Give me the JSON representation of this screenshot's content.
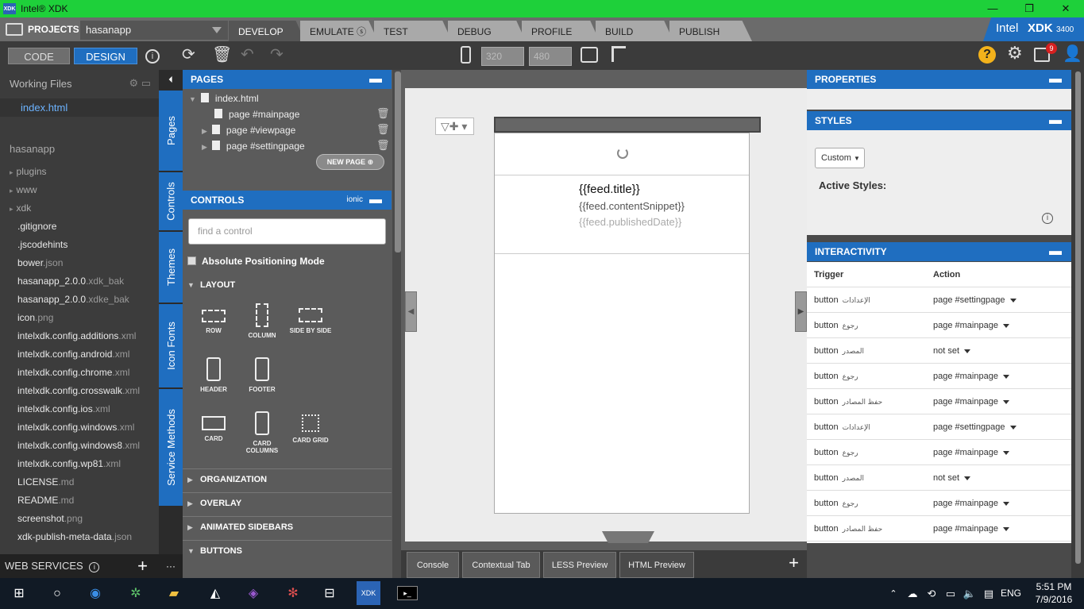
{
  "window": {
    "title": "Intel® XDK",
    "icon_text": "XDK",
    "minimize": "—",
    "maximize": "❐",
    "close": "✕"
  },
  "tabs": {
    "projects_label": "PROJECTS",
    "project_name": "hasanapp",
    "main": [
      {
        "label": "DEVELOP",
        "active": true
      },
      {
        "label": "EMULATE ⓢ"
      },
      {
        "label": "TEST"
      },
      {
        "label": "DEBUG"
      },
      {
        "label": "PROFILE"
      },
      {
        "label": "BUILD"
      },
      {
        "label": "PUBLISH"
      }
    ],
    "brand": "Intel",
    "brand_product": "XDK",
    "brand_version": "3400"
  },
  "toolbar": {
    "code_label": "CODE",
    "design_label": "DESIGN",
    "width_value": "320",
    "height_value": "480",
    "notification_count": "9"
  },
  "files": {
    "header": "Working Files",
    "open_file": "index.html",
    "project": "hasanapp",
    "folders": [
      "plugins",
      "www",
      "xdk"
    ],
    "items": [
      {
        "name": ".gitignore",
        "ext": ""
      },
      {
        "name": ".jscodehints",
        "ext": ""
      },
      {
        "name": "bower",
        "ext": ".json"
      },
      {
        "name": "hasanapp_2.0.0",
        "ext": ".xdk_bak"
      },
      {
        "name": "hasanapp_2.0.0",
        "ext": ".xdke_bak"
      },
      {
        "name": "icon",
        "ext": ".png"
      },
      {
        "name": "intelxdk.config.additions",
        "ext": ".xml"
      },
      {
        "name": "intelxdk.config.android",
        "ext": ".xml"
      },
      {
        "name": "intelxdk.config.chrome",
        "ext": ".xml"
      },
      {
        "name": "intelxdk.config.crosswalk",
        "ext": ".xml"
      },
      {
        "name": "intelxdk.config.ios",
        "ext": ".xml"
      },
      {
        "name": "intelxdk.config.windows",
        "ext": ".xml"
      },
      {
        "name": "intelxdk.config.windows8",
        "ext": ".xml"
      },
      {
        "name": "intelxdk.config.wp81",
        "ext": ".xml"
      },
      {
        "name": "LICENSE",
        "ext": ".md"
      },
      {
        "name": "README",
        "ext": ".md"
      },
      {
        "name": "screenshot",
        "ext": ".png"
      },
      {
        "name": "xdk-publish-meta-data",
        "ext": ".json"
      }
    ],
    "web_services": "WEB SERVICES"
  },
  "vtabs": [
    "Pages",
    "Controls",
    "Themes",
    "Icon Fonts",
    "Service Methods"
  ],
  "pages_panel": {
    "header": "PAGES",
    "root": "index.html",
    "pages": [
      "page #mainpage",
      "page #viewpage",
      "page #settingpage"
    ],
    "new_page": "NEW PAGE"
  },
  "controls_panel": {
    "header": "CONTROLS",
    "framework": "ionic",
    "search_placeholder": "find a control",
    "abs_positioning": "Absolute Positioning Mode",
    "layout": "LAYOUT",
    "layout_items": [
      "ROW",
      "COLUMN",
      "SIDE BY SIDE",
      "HEADER",
      "FOOTER",
      "CARD",
      "CARD COLUMNS",
      "CARD GRID"
    ],
    "sections": [
      "ORGANIZATION",
      "OVERLAY",
      "ANIMATED SIDEBARS",
      "BUTTONS"
    ]
  },
  "preview": {
    "feed_title": "{{feed.title}}",
    "feed_snippet": "{{feed.contentSnippet}}",
    "feed_date": "{{feed.publishedDate}}"
  },
  "bottom_tabs": [
    "Console",
    "Contextual Tab",
    "LESS Preview",
    "HTML Preview"
  ],
  "right_panel": {
    "properties": "PROPERTIES",
    "styles": "STYLES",
    "custom": "Custom",
    "active_styles": "Active Styles:",
    "interactivity": "INTERACTIVITY",
    "trigger_col": "Trigger",
    "action_col": "Action",
    "rows": [
      {
        "trigger": "button",
        "label": "الإعدادات",
        "action": "page #settingpage"
      },
      {
        "trigger": "button",
        "label": "رجوع",
        "action": "page #mainpage"
      },
      {
        "trigger": "button",
        "label": "المصدر",
        "action": "not set"
      },
      {
        "trigger": "button",
        "label": "رجوع",
        "action": "page #mainpage"
      },
      {
        "trigger": "button",
        "label": "حفظ المصادر",
        "action": "page #mainpage"
      },
      {
        "trigger": "button",
        "label": "الإعدادات",
        "action": "page #settingpage"
      },
      {
        "trigger": "button",
        "label": "رجوع",
        "action": "page #mainpage"
      },
      {
        "trigger": "button",
        "label": "المصدر",
        "action": "not set"
      },
      {
        "trigger": "button",
        "label": "رجوع",
        "action": "page #mainpage"
      },
      {
        "trigger": "button",
        "label": "حفظ المصادر",
        "action": "page #mainpage"
      }
    ]
  },
  "taskbar": {
    "language": "ENG",
    "time": "5:51 PM",
    "date": "7/9/2016"
  }
}
